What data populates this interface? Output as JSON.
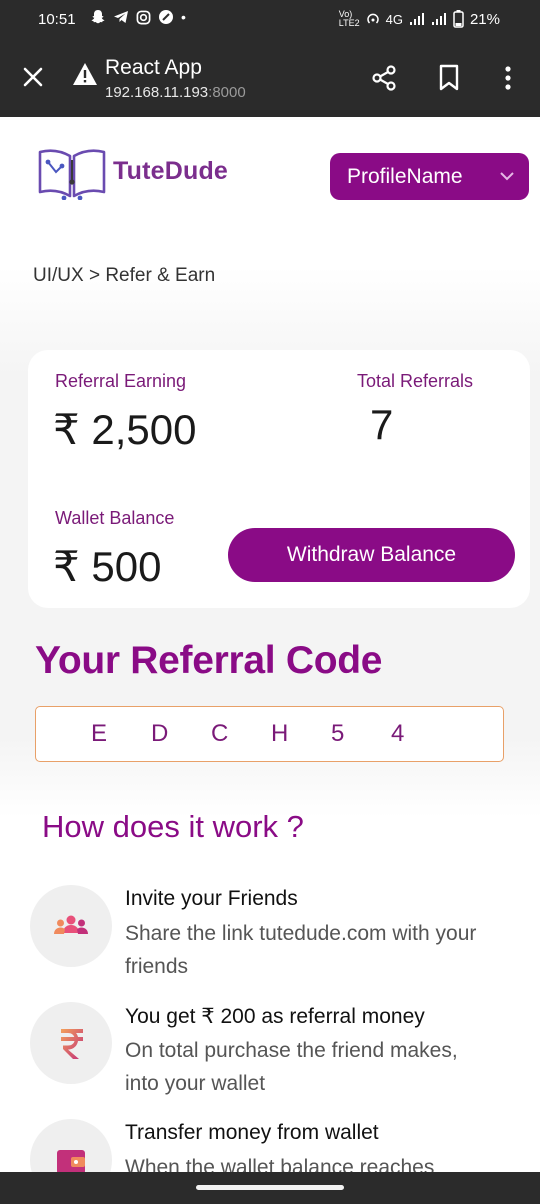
{
  "status_bar": {
    "time": "10:51",
    "network": "4G",
    "battery": "21%"
  },
  "browser": {
    "title": "React App",
    "url_host": "192.168.11.193",
    "url_port": ":8000"
  },
  "header": {
    "logo_text": "TuteDude",
    "profile_label": "ProfileName"
  },
  "breadcrumb": "UI/UX > Refer & Earn",
  "stats": {
    "referral_earning_label": "Referral Earning",
    "referral_earning_value": "₹ 2,500",
    "total_referrals_label": "Total Referrals",
    "total_referrals_value": "7",
    "wallet_balance_label": "Wallet Balance",
    "wallet_balance_value": "₹ 500",
    "withdraw_label": "Withdraw Balance"
  },
  "referral": {
    "title": "Your Referral Code",
    "code": [
      "E",
      "D",
      "C",
      "H",
      "5",
      "4"
    ]
  },
  "how": {
    "title": "How does it work ?",
    "steps": [
      {
        "title": "Invite your Friends",
        "desc": "Share the link tutedude.com with your friends",
        "icon": "group-icon"
      },
      {
        "title": "You get ₹ 200 as referral money",
        "desc": "On total purchase the friend makes, into your wallet",
        "icon": "rupee-icon"
      },
      {
        "title": "Transfer money from wallet",
        "desc": "When the wallet balance reaches",
        "icon": "wallet-icon"
      }
    ]
  },
  "colors": {
    "brand": "#8a0b86",
    "accent_orange": "#e8a068"
  }
}
